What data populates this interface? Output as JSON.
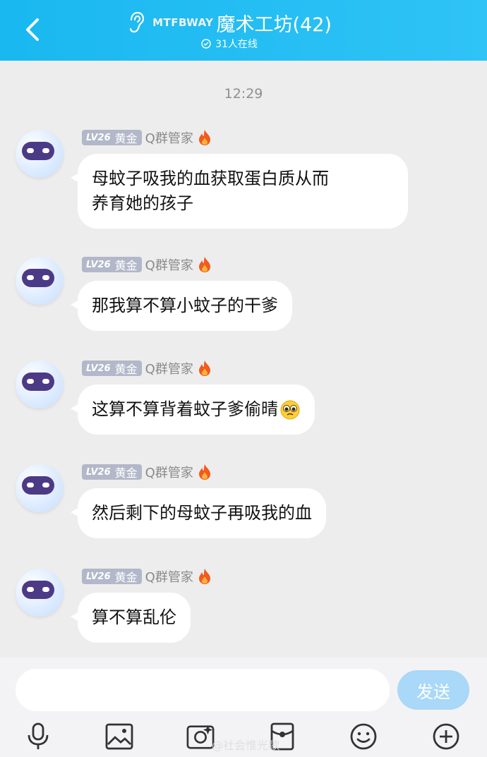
{
  "header": {
    "brand": "MTFBWAY",
    "title": "魔术工坊(42)",
    "online": "31人在线"
  },
  "time": "12:29",
  "sender": {
    "level": "LV26",
    "rank": "黄金",
    "name": "Q群管家"
  },
  "messages": [
    {
      "text_line1": "母蚊子吸我的血获取蛋白质从而",
      "text_line2": "养育她的孩子"
    },
    {
      "text_line1": "那我算不算小蚊子的干爹"
    },
    {
      "text_line1": "这算不算背着蚊子爹偷晴"
    },
    {
      "text_line1": "然后剩下的母蚊子再吸我的血"
    },
    {
      "text_line1": "算不算乱伦"
    }
  ],
  "composer": {
    "input_value": "",
    "send_label": "发送"
  },
  "watermark": "@社会惟光歌"
}
